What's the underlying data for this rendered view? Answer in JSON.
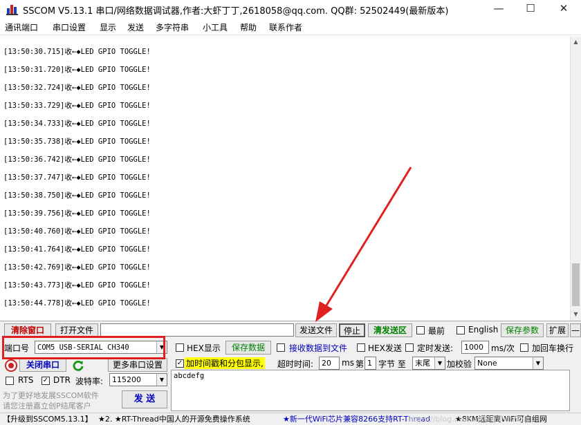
{
  "window": {
    "title": "SSCOM V5.13.1 串口/网络数据调试器,作者:大虾丁丁,2618058@qq.com. QQ群: 52502449(最新版本)",
    "minimize": "—",
    "maximize": "☐",
    "close": "✕"
  },
  "menu": [
    "通讯端口",
    "串口设置",
    "显示",
    "发送",
    "多字符串",
    "小工具",
    "帮助",
    "联系作者"
  ],
  "log": [
    "[13:50:30.715]收←◆LED GPIO TOGGLE!",
    "[13:50:31.720]收←◆LED GPIO TOGGLE!",
    "[13:50:32.724]收←◆LED GPIO TOGGLE!",
    "[13:50:33.729]收←◆LED GPIO TOGGLE!",
    "[13:50:34.733]收←◆LED GPIO TOGGLE!",
    "[13:50:35.738]收←◆LED GPIO TOGGLE!",
    "[13:50:36.742]收←◆LED GPIO TOGGLE!",
    "[13:50:37.747]收←◆LED GPIO TOGGLE!",
    "[13:50:38.750]收←◆LED GPIO TOGGLE!",
    "[13:50:39.756]收←◆LED GPIO TOGGLE!",
    "[13:50:40.760]收←◆LED GPIO TOGGLE!",
    "[13:50:41.764]收←◆LED GPIO TOGGLE!",
    "[13:50:42.769]收←◆LED GPIO TOGGLE!",
    "[13:50:43.773]收←◆LED GPIO TOGGLE!",
    "[13:50:44.778]收←◆LED GPIO TOGGLE!"
  ],
  "toolbar": {
    "clear_window": "清除窗口",
    "open_file": "打开文件",
    "file_path": "",
    "send_file": "发送文件",
    "stop": "停止",
    "clear_send": "清发送区",
    "topmost": "最前",
    "english": "English",
    "save_params": "保存参数",
    "expand": "扩展",
    "collapse": "—"
  },
  "port": {
    "label": "端口号",
    "value": "COM5 USB-SERIAL CH340",
    "close_port": "关闭串口",
    "more_settings": "更多串口设置",
    "rts_label": "RTS",
    "rts_checked": false,
    "dtr_label": "DTR",
    "dtr_checked": true,
    "baud_label": "波特率:",
    "baud_value": "115200",
    "promo_line1": "为了更好地发展SSCOM软件",
    "promo_line2": "请您注册嘉立创P结尾客户",
    "send_button": "发 送"
  },
  "options": {
    "hex_display": "HEX显示",
    "hex_display_checked": false,
    "save_data": "保存数据",
    "recv_to_file": "接收数据到文件",
    "recv_to_file_checked": false,
    "hex_send": "HEX发送",
    "hex_send_checked": false,
    "timed_send": "定时发送:",
    "timed_send_checked": false,
    "interval": "1000",
    "interval_unit": "ms/次",
    "add_crlf": "加回车换行",
    "add_crlf_checked": false,
    "timestamp": "加时间戳和分包显示,",
    "timestamp_checked": true,
    "timeout_label": "超时时间:",
    "timeout_value": "20",
    "timeout_unit": "ms",
    "byte_prefix": "第",
    "byte_index": "1",
    "byte_suffix": "字节 至",
    "byte_end": "末尾",
    "checksum_label": "加校验",
    "checksum_value": "None"
  },
  "send_text": "abcdefg",
  "status": [
    "【升级到SSCOM5.13.1】",
    "★2. ★RT-Thread中国人的开源免费操作系统",
    "★新一代WiFi芯片兼容8266支持RT-Thread",
    "★8KM远距离WiFi可自组网"
  ],
  "watermark": "https://blog.csdn.net/Williamcsj",
  "colors": {
    "annotation": "#e02020",
    "highlight": "#ffff00",
    "accent_blue": "#0000c0",
    "accent_green": "#008000"
  }
}
